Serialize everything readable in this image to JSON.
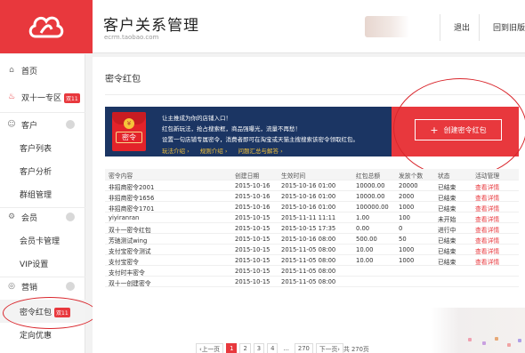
{
  "header": {
    "app_title": "客户关系管理",
    "app_sub": "ecrm.taobao.com",
    "logout": "退出",
    "back_old": "回到旧版"
  },
  "sidebar": {
    "home": "首页",
    "double11": "双十一专区",
    "double11_badge": "双11",
    "customer": "客户",
    "customer_list": "客户列表",
    "customer_analysis": "客户分析",
    "group_mgmt": "群组管理",
    "member": "会员",
    "member_card": "会员卡管理",
    "vip_settings": "VIP设置",
    "marketing": "营销",
    "password_hongbao": "密令红包",
    "password_hongbao_badge": "双11",
    "targeted_offer": "定向优惠"
  },
  "main": {
    "title": "密令红包",
    "banner": {
      "envelope_label": "密令",
      "line1": "让主推成为你的店铺入口！",
      "line2": "红包新玩法，抢占搜索框，商品强曝光，流量不再愁！",
      "line3": "设置一句店铺专属密令，消费者即可在淘宝或天猫主搜搜索该密令领取红包。",
      "links": [
        "玩法介绍 ›",
        "规则介绍 ›",
        "问题汇总与解答 ›"
      ],
      "create_button": "创建密令红包"
    },
    "table": {
      "headers": [
        "密令内容",
        "创建日期",
        "生效时间",
        "红包总额",
        "发放个数",
        "状态",
        "活动管理"
      ],
      "rows": [
        [
          "非招商密令2001",
          "2015-10-16",
          "2015-10-16 01:00",
          "10000.00",
          "20000",
          "已结束",
          "查看详情"
        ],
        [
          "非招商密令1656",
          "2015-10-16",
          "2015-10-16 01:00",
          "10000.00",
          "2000",
          "已结束",
          "查看详情"
        ],
        [
          "非招商密令1701",
          "2015-10-16",
          "2015-10-16 01:00",
          "100000.00",
          "1000",
          "已结束",
          "查看详情"
        ],
        [
          "yiyiranran",
          "2015-10-15",
          "2015-11-11 11:11",
          "1.00",
          "100",
          "未开始",
          "查看详情"
        ],
        [
          "双十一密令红包",
          "2015-10-15",
          "2015-10-15 17:35",
          "0.00",
          "0",
          "进行中",
          "查看详情"
        ],
        [
          "芳驰测试wing",
          "2015-10-15",
          "2015-10-16 08:00",
          "500.00",
          "50",
          "已结束",
          "查看详情"
        ],
        [
          "支付宝密令测试",
          "2015-10-15",
          "2015-11-05 08:00",
          "10.00",
          "1000",
          "已结束",
          "查看详情"
        ],
        [
          "支付宝密令",
          "2015-10-15",
          "2015-11-05 08:00",
          "10.00",
          "1000",
          "已结束",
          "查看详情"
        ],
        [
          "支付时丰密令",
          "2015-10-15",
          "2015-11-05 08:00",
          "",
          "",
          "",
          ""
        ],
        [
          "双十一创建密令",
          "2015-10-15",
          "2015-11-05 08:00",
          "",
          "",
          "",
          ""
        ]
      ]
    },
    "pager": {
      "prev": "‹上一页",
      "pages": [
        "1",
        "2",
        "3",
        "4"
      ],
      "ellipsis": "...",
      "last": "270",
      "next": "下一页›",
      "total": "共 270页"
    }
  },
  "colors": {
    "accent": "#e8383d",
    "banner_bg": "#1b3563",
    "gold": "#f6c43a"
  }
}
